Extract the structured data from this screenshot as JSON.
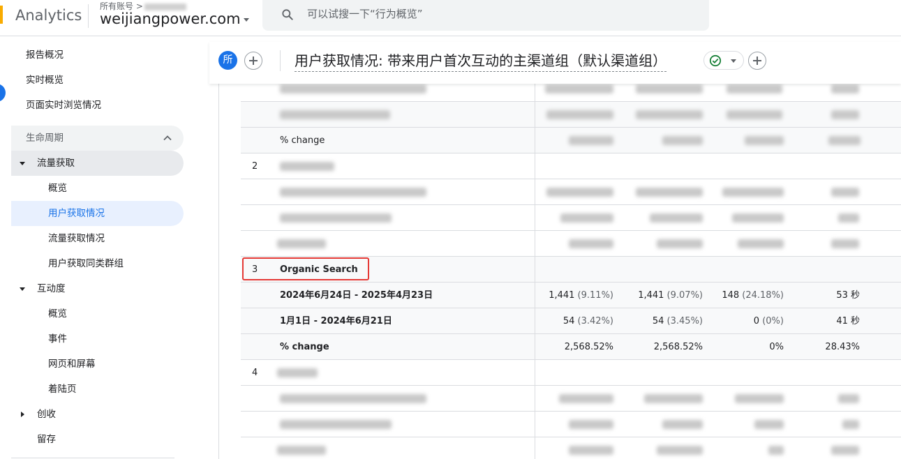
{
  "topbar": {
    "app_name": "Analytics",
    "account_crumb": "所有账号 >",
    "property": "weijiangpower.com",
    "search_placeholder": "可以试搜一下“行为概览”"
  },
  "sidebar": {
    "items": [
      {
        "label": "报告概况"
      },
      {
        "label": "实时概览"
      },
      {
        "label": "页面实时浏览情况"
      },
      {
        "label": "生命周期"
      },
      {
        "label": "流量获取"
      },
      {
        "label": "概览"
      },
      {
        "label": "用户获取情况"
      },
      {
        "label": "流量获取情况"
      },
      {
        "label": "用户获取同类群组"
      },
      {
        "label": "互动度"
      },
      {
        "label": "概览"
      },
      {
        "label": "事件"
      },
      {
        "label": "网页和屏幕"
      },
      {
        "label": "着陆页"
      },
      {
        "label": "创收"
      },
      {
        "label": "留存"
      }
    ]
  },
  "report": {
    "all_badge": "所",
    "title": "用户获取情况: 带来用户首次互动的主渠道组（默认渠道组）"
  },
  "table": {
    "row_top_change_label": "% change",
    "group2_index": "2",
    "group3_index": "3",
    "group3_name": "Organic Search",
    "group3_rows": [
      {
        "label": "2024年6月24日 - 2025年4月23日",
        "c1": "1,441",
        "c1p": "(9.11%)",
        "c2": "1,441",
        "c2p": "(9.07%)",
        "c3": "148",
        "c3p": "(24.18%)",
        "c4": "53 秒"
      },
      {
        "label": "1月1日 - 2024年6月21日",
        "c1": "54",
        "c1p": "(3.42%)",
        "c2": "54",
        "c2p": "(3.45%)",
        "c3": "0",
        "c3p": "(0%)",
        "c4": "41 秒"
      },
      {
        "label": "% change",
        "c1": "2,568.52%",
        "c1p": "",
        "c2": "2,568.52%",
        "c2p": "",
        "c3": "0%",
        "c3p": "",
        "c4": "28.43%"
      }
    ],
    "group4_index": "4"
  },
  "colors": {
    "accent": "#1a73e8",
    "highlight": "#e53935",
    "logo": "#f9ab00"
  }
}
